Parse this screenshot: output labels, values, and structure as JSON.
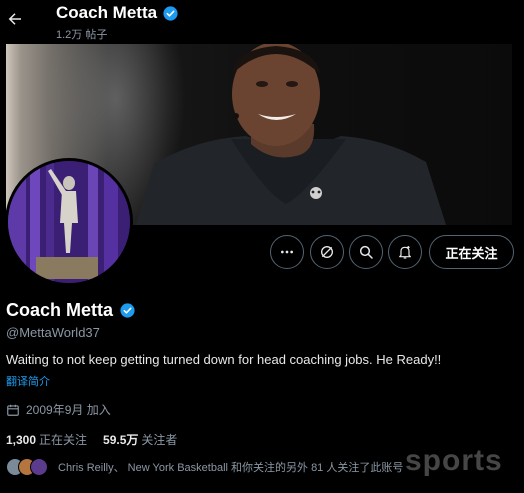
{
  "header": {
    "profile_name": "Coach Metta",
    "post_count": "1.2万 帖子"
  },
  "actions": {
    "follow_label": "正在关注"
  },
  "profile": {
    "name": "Coach Metta",
    "handle": "@MettaWorld37",
    "bio": "Waiting to not keep getting turned down for head coaching jobs. He Ready!!",
    "translate_label": "翻译简介",
    "joined": "2009年9月 加入"
  },
  "stats": {
    "following_count": "1,300",
    "following_label": "正在关注",
    "followers_count": "59.5万",
    "followers_label": "关注者"
  },
  "followed_by": {
    "text": "Chris Reilly、 New York Basketball 和你关注的另外 81 人关注了此账号"
  },
  "watermark": {
    "text": "sports"
  },
  "colors": {
    "accent": "#1d9bf0",
    "verified": "#1d9bf0",
    "background": "#000000",
    "muted_text": "#8b98a5"
  },
  "icons": [
    "arrow-left-icon",
    "verified-badge-icon",
    "more-icon",
    "grok-icon",
    "search-icon",
    "notification-bell-icon",
    "calendar-icon"
  ]
}
